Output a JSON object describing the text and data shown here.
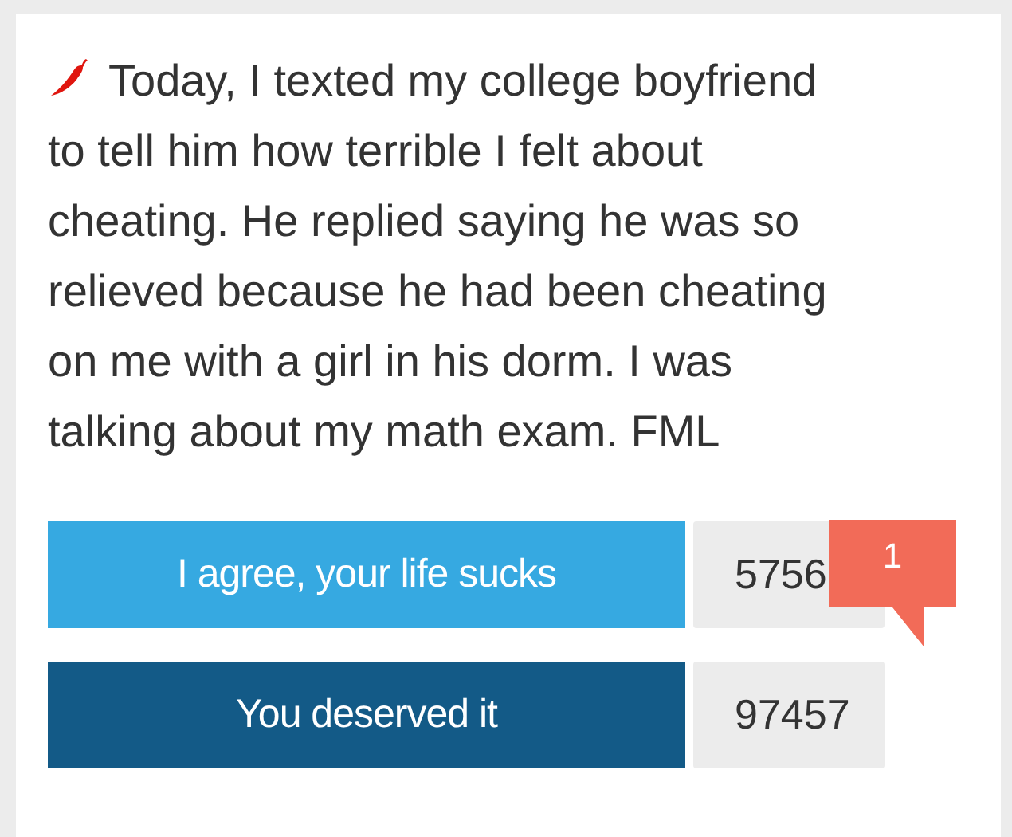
{
  "post": {
    "text": "Today, I texted my college boyfriend to tell him how terrible I felt about cheating. He replied saying he was so relieved because he had been cheating on me with a girl in his dorm. I was talking about my math exam. FML"
  },
  "votes": [
    {
      "kind": "agree",
      "label": "I agree, your life sucks",
      "count": "5756",
      "badge": "1"
    },
    {
      "kind": "deserved",
      "label": "You deserved it",
      "count": "97457"
    }
  ]
}
